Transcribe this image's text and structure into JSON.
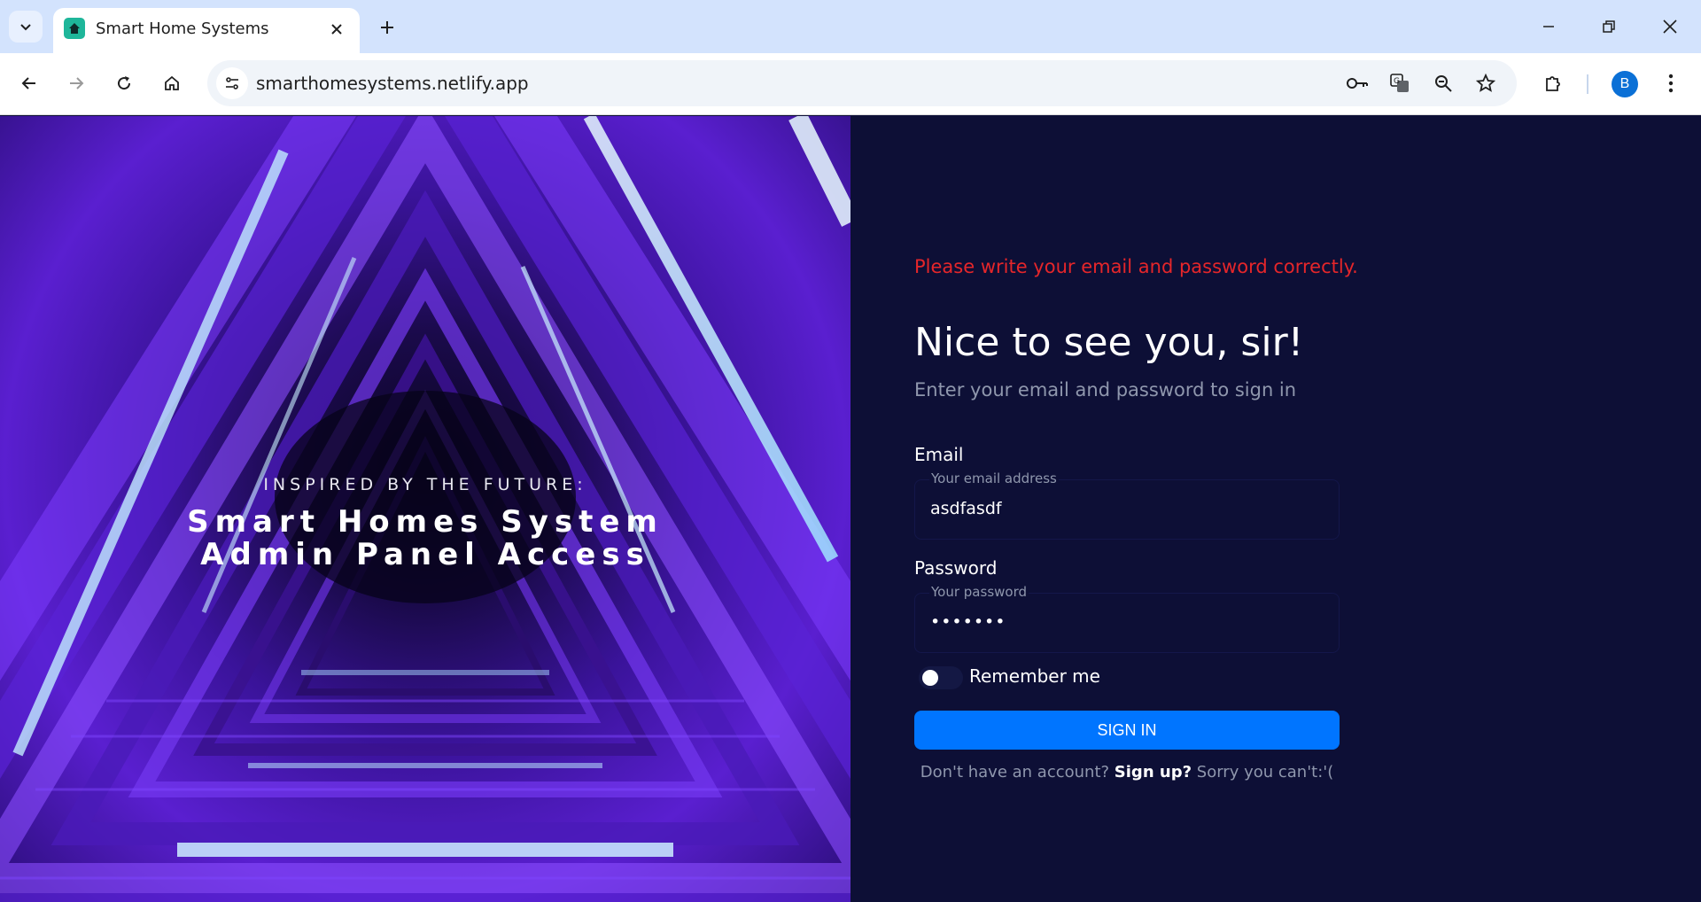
{
  "browser": {
    "tab_title": "Smart Home Systems",
    "url": "smarthomesystems.netlify.app",
    "profile_initial": "B"
  },
  "hero": {
    "eyebrow": "INSPIRED BY THE FUTURE:",
    "title_line1": "Smart Homes System",
    "title_line2": "Admin Panel Access"
  },
  "form": {
    "error": "Please write your email and password correctly.",
    "heading": "Nice to see you, sir!",
    "subheading": "Enter your email and password to sign in",
    "email": {
      "label": "Email",
      "legend": "Your email address",
      "value": "asdfasdf"
    },
    "password": {
      "label": "Password",
      "legend": "Your password",
      "value": "•••••••"
    },
    "remember_label": "Remember me",
    "remember_on": false,
    "signin_label": "SIGN IN",
    "footer": {
      "prefix": "Don't have an account?",
      "link": "Sign up?",
      "suffix": "Sorry you can't:'("
    }
  },
  "colors": {
    "page_bg": "#0d0f36",
    "error": "#e5262a",
    "primary": "#0075ff",
    "muted": "#8f97ad"
  }
}
